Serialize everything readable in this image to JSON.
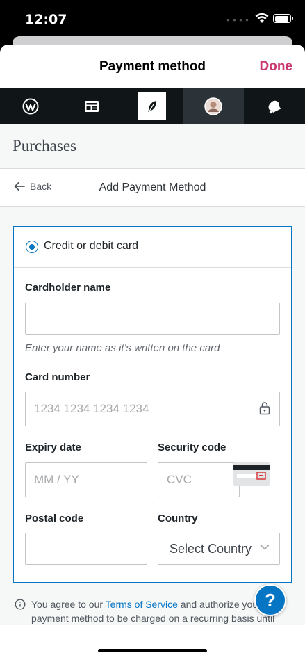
{
  "status_bar": {
    "time": "12:07",
    "signal_icon": "signal-dots-icon",
    "wifi_icon": "wifi-icon",
    "battery_icon": "battery-icon"
  },
  "header": {
    "title": "Payment method",
    "done_label": "Done",
    "done_color": "#c9356e"
  },
  "tabs": [
    {
      "icon": "wordpress-icon"
    },
    {
      "icon": "reader-icon"
    },
    {
      "icon": "feather-icon"
    },
    {
      "icon": "avatar-icon"
    },
    {
      "icon": "notifications-icon"
    }
  ],
  "page": {
    "section_title": "Purchases",
    "back_label": "Back",
    "subtitle": "Add Payment Method"
  },
  "form": {
    "method_label": "Credit or debit card",
    "cardholder_label": "Cardholder name",
    "cardholder_value": "",
    "cardholder_hint": "Enter your name as it's written on the card",
    "card_number_label": "Card number",
    "card_number_placeholder": "1234 1234 1234 1234",
    "expiry_label": "Expiry date",
    "expiry_placeholder": "MM / YY",
    "security_label": "Security code",
    "security_placeholder": "CVC",
    "postal_label": "Postal code",
    "postal_value": "",
    "country_label": "Country",
    "country_selected": "Select Country"
  },
  "agreement": {
    "text_before": "You agree to our ",
    "tos_link": "Terms of Service",
    "text_after": " and authorize your payment method to be charged on a recurring basis until you cancel, which you can do at any time. You understand"
  },
  "help_button_label": "?",
  "colors": {
    "accent_blue": "#0675c4",
    "tab_bar_bg": "#101517"
  }
}
